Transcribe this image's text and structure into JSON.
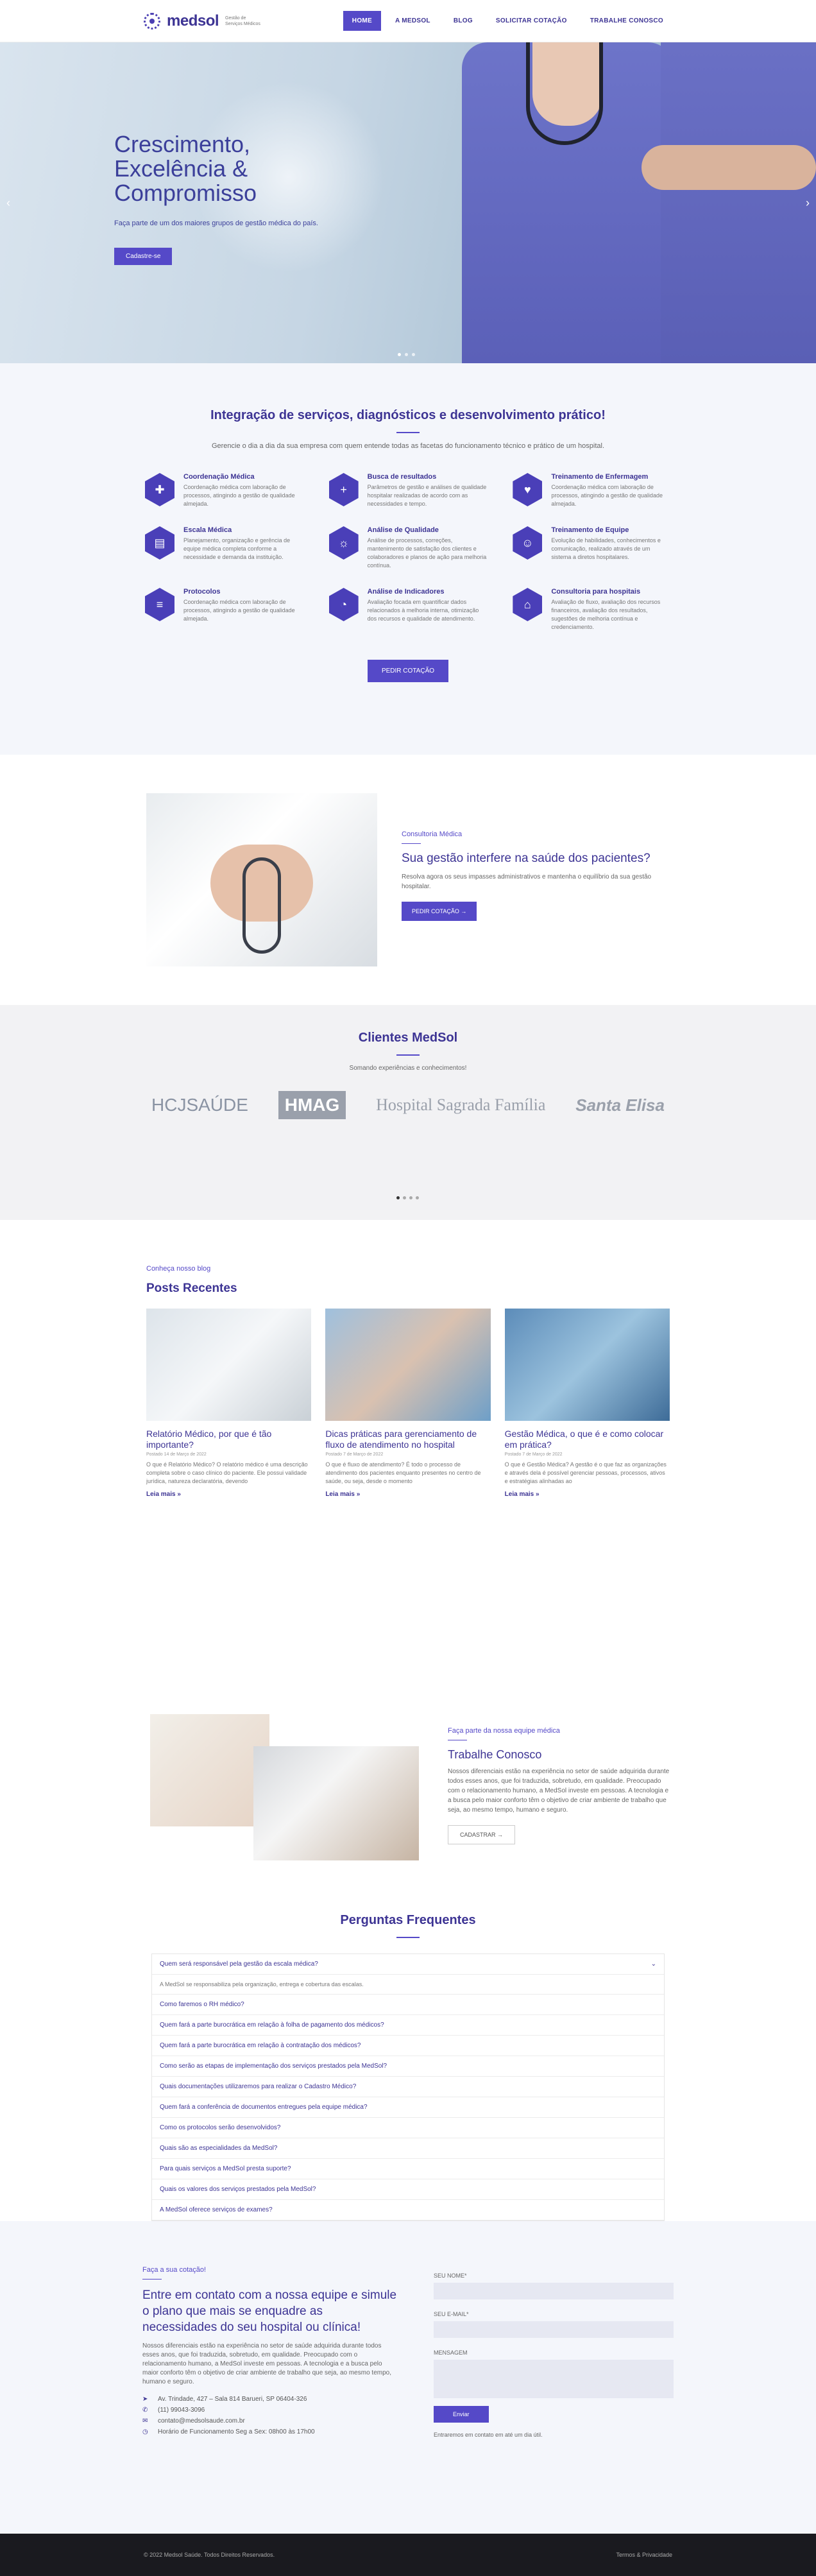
{
  "header": {
    "logo": "medsol",
    "logo_sub": "Gestão de Serviços Médicos",
    "nav": [
      "HOME",
      "A MEDSOL",
      "BLOG",
      "SOLICITAR COTAÇÃO",
      "TRABALHE CONOSCO"
    ]
  },
  "hero": {
    "title": "Crescimento, Excelência & Compromisso",
    "subtitle": "Faça parte de um dos maiores grupos de gestão médica do país.",
    "button": "Cadastre-se",
    "prev": "‹",
    "next": "›"
  },
  "services": {
    "title": "Integração de serviços, diagnósticos e desenvolvimento prático!",
    "desc": "Gerencie o dia a dia da sua empresa com quem entende todas as facetas do funcionamento técnico e prático de um hospital.",
    "button": "PEDIR COTAÇÃO",
    "items": [
      {
        "t": "Coordenação Médica",
        "d": "Coordenação médica com laboração de processos, atingindo a gestão de qualidade almejada."
      },
      {
        "t": "Busca de resultados",
        "d": "Parâmetros de gestão e análises de qualidade hospitalar realizadas de acordo com as necessidades e tempo."
      },
      {
        "t": "Treinamento de Enfermagem",
        "d": "Coordenação médica com laboração de processos, atingindo a gestão de qualidade almejada."
      },
      {
        "t": "Escala Médica",
        "d": "Planejamento, organização e gerência de equipe médica completa conforme a necessidade e demanda da instituição."
      },
      {
        "t": "Análise de Qualidade",
        "d": "Análise de processos, correções, mantenimento de satisfação dos clientes e colaboradores e planos de ação para melhoria contínua."
      },
      {
        "t": "Treinamento de Equipe",
        "d": "Evolução de habilidades, conhecimentos e comunicação, realizado através de um sistema a diretos hospitalares."
      },
      {
        "t": "Protocolos",
        "d": "Coordenação médica com laboração de processos, atingindo a gestão de qualidade almejada."
      },
      {
        "t": "Análise de Indicadores",
        "d": "Avaliação focada em quantificar dados relacionados à melhoria interna, otimização dos recursos e qualidade de atendimento."
      },
      {
        "t": "Consultoria para hospitais",
        "d": "Avaliação de fluxo, avaliação dos recursos financeiros, avaliação dos resultados, sugestões de melhoria contínua e credenciamento."
      }
    ]
  },
  "consult": {
    "kicker": "Consultoria Médica",
    "title": "Sua gestão interfere na saúde dos pacientes?",
    "desc": "Resolva agora os seus impasses administrativos e mantenha o equilíbrio da sua gestão hospitalar.",
    "button": "PEDIR COTAÇÃO"
  },
  "clients": {
    "title": "Clientes MedSol",
    "sub": "Somando experiências e conhecimentos!",
    "logos": [
      "HCJSAÚDE",
      "HMAG",
      "Hospital Sagrada Família",
      "Santa Elisa"
    ]
  },
  "blog": {
    "kicker": "Conheça nosso blog",
    "title": "Posts Recentes",
    "more": "Leia mais »",
    "posts": [
      {
        "t": "Relatório Médico, por que é tão importante?",
        "date": "Postado 14 de Março de 2022",
        "d": "O que é Relatório Médico? O relatório médico é uma descrição completa sobre o caso clínico do paciente. Ele possui validade jurídica, natureza declaratória, devendo"
      },
      {
        "t": "Dicas práticas para gerenciamento de fluxo de atendimento no hospital",
        "date": "Postado 7 de Março de 2022",
        "d": "O que é fluxo de atendimento? É todo o processo de atendimento dos pacientes enquanto presentes no centro de saúde, ou seja, desde o momento"
      },
      {
        "t": "Gestão Médica, o que é e como colocar em prática?",
        "date": "Postado 7 de Março de 2022",
        "d": "O que é Gestão Médica? A gestão é o que faz as organizações e através dela é possível gerenciar pessoas, processos, ativos e estratégias alinhadas ao"
      }
    ]
  },
  "work": {
    "kicker": "Faça parte da nossa equipe médica",
    "title": "Trabalhe Conosco",
    "desc": "Nossos diferenciais estão na experiência no setor de saúde adquirida durante todos esses anos, que foi traduzida, sobretudo, em qualidade. Preocupado com o relacionamento humano, a MedSol investe em pessoas. A tecnologia e a busca pelo maior conforto têm o objetivo de criar ambiente de trabalho que seja, ao mesmo tempo, humano e seguro.",
    "button": "CADASTRAR"
  },
  "faq": {
    "title": "Perguntas Frequentes",
    "answer": "A MedSol se responsabiliza pela organização, entrega e cobertura das escalas.",
    "items": [
      "Quem será responsável pela gestão da escala médica?",
      "Como faremos o RH médico?",
      "Quem fará a parte burocrática em relação à folha de pagamento dos médicos?",
      "Quem fará a parte burocrática em relação à contratação dos médicos?",
      "Como serão as etapas de implementação dos serviços prestados pela MedSol?",
      "Quais documentações utilizaremos para realizar o Cadastro Médico?",
      "Quem fará a conferência de documentos entregues pela equipe médica?",
      "Como os protocolos serão desenvolvidos?",
      "Quais são as especialidades da MedSol?",
      "Para quais serviços a MedSol presta suporte?",
      "Quais os valores dos serviços prestados pela MedSol?",
      "A MedSol oferece serviços de exames?"
    ]
  },
  "contact": {
    "kicker": "Faça a sua cotação!",
    "title": "Entre em contato com a nossa equipe e simule o plano que mais se enquadre as necessidades do seu hospital ou clínica!",
    "desc": "Nossos diferenciais estão na experiência no setor de saúde adquirida durante todos esses anos, que foi traduzida, sobretudo, em qualidade. Preocupado com o relacionamento humano, a MedSol investe em pessoas. A tecnologia e a busca pelo maior conforto têm o objetivo de criar ambiente de trabalho que seja, ao mesmo tempo, humano e seguro.",
    "address": "Av. Trindade, 427 – Sala 814 Barueri, SP 06404-326",
    "phone": "(11) 99043-3096",
    "email": "contato@medsolsaude.com.br",
    "hours": "Horário de Funcionamento Seg a Sex: 08h00 às 17h00",
    "form": {
      "name": "SEU NOME*",
      "email": "SEU E-MAIL*",
      "message": "MENSAGEM",
      "button": "Enviar",
      "note": "Entraremos em contato em até um dia útil."
    }
  },
  "footer": {
    "copy": "© 2022 Medsol Saúde. Todos Direitos Reservados.",
    "policy": "Termos & Privacidade"
  }
}
